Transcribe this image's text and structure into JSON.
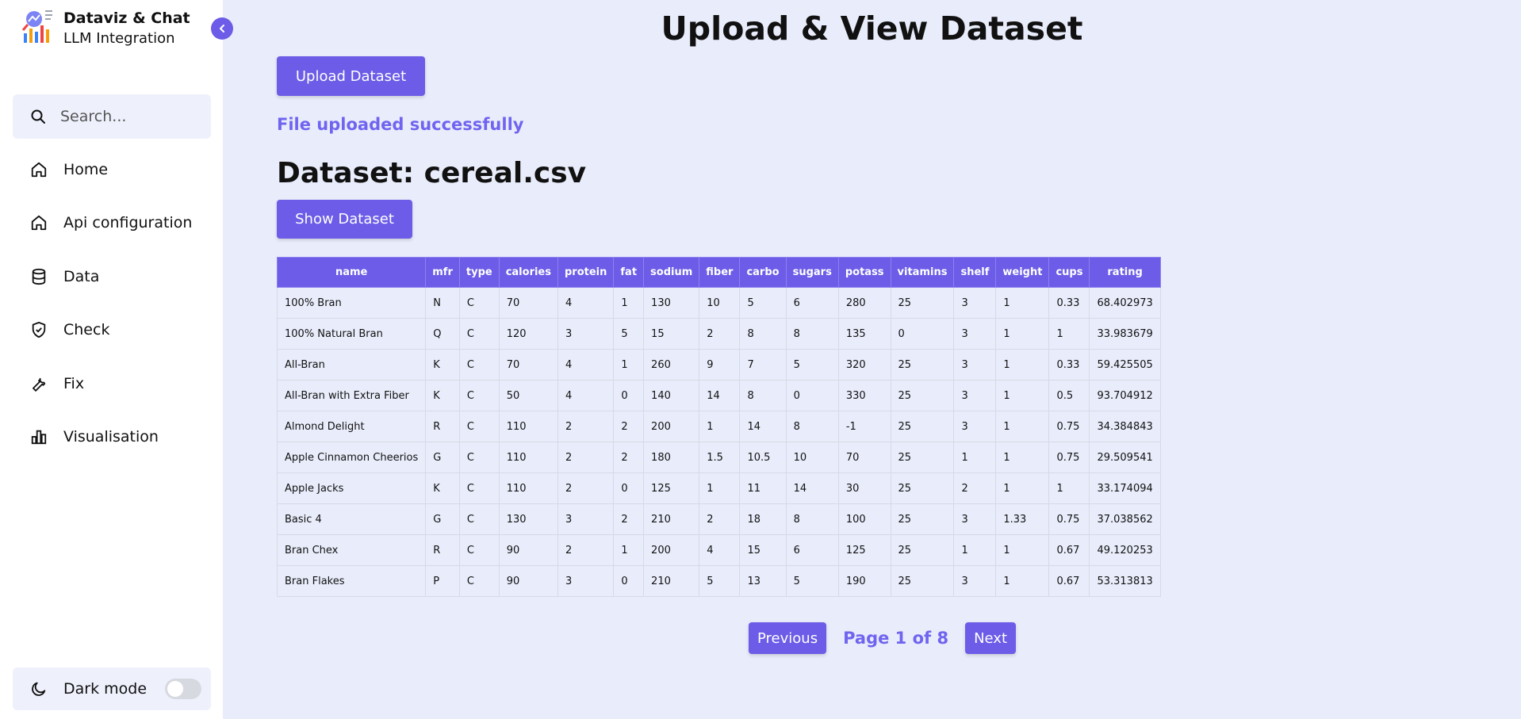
{
  "sidebar": {
    "brand": {
      "title": "Dataviz & Chat",
      "subtitle": "LLM Integration"
    },
    "search": {
      "placeholder": "Search..."
    },
    "items": [
      {
        "label": "Home",
        "icon": "home-icon"
      },
      {
        "label": "Api configuration",
        "icon": "home-icon"
      },
      {
        "label": "Data",
        "icon": "database-icon"
      },
      {
        "label": "Check",
        "icon": "shield-check-icon"
      },
      {
        "label": "Fix",
        "icon": "wrench-icon"
      },
      {
        "label": "Visualisation",
        "icon": "bar-chart-icon"
      }
    ],
    "dark_mode": {
      "label": "Dark mode",
      "enabled": false
    }
  },
  "main": {
    "title": "Upload & View Dataset",
    "upload_label": "Upload Dataset",
    "status": "File uploaded successfully",
    "dataset_title": "Dataset: cereal.csv",
    "show_label": "Show Dataset"
  },
  "table": {
    "columns": [
      "name",
      "mfr",
      "type",
      "calories",
      "protein",
      "fat",
      "sodium",
      "fiber",
      "carbo",
      "sugars",
      "potass",
      "vitamins",
      "shelf",
      "weight",
      "cups",
      "rating"
    ],
    "rows": [
      [
        "100% Bran",
        "N",
        "C",
        "70",
        "4",
        "1",
        "130",
        "10",
        "5",
        "6",
        "280",
        "25",
        "3",
        "1",
        "0.33",
        "68.402973"
      ],
      [
        "100% Natural Bran",
        "Q",
        "C",
        "120",
        "3",
        "5",
        "15",
        "2",
        "8",
        "8",
        "135",
        "0",
        "3",
        "1",
        "1",
        "33.983679"
      ],
      [
        "All-Bran",
        "K",
        "C",
        "70",
        "4",
        "1",
        "260",
        "9",
        "7",
        "5",
        "320",
        "25",
        "3",
        "1",
        "0.33",
        "59.425505"
      ],
      [
        "All-Bran with Extra Fiber",
        "K",
        "C",
        "50",
        "4",
        "0",
        "140",
        "14",
        "8",
        "0",
        "330",
        "25",
        "3",
        "1",
        "0.5",
        "93.704912"
      ],
      [
        "Almond Delight",
        "R",
        "C",
        "110",
        "2",
        "2",
        "200",
        "1",
        "14",
        "8",
        "-1",
        "25",
        "3",
        "1",
        "0.75",
        "34.384843"
      ],
      [
        "Apple Cinnamon Cheerios",
        "G",
        "C",
        "110",
        "2",
        "2",
        "180",
        "1.5",
        "10.5",
        "10",
        "70",
        "25",
        "1",
        "1",
        "0.75",
        "29.509541"
      ],
      [
        "Apple Jacks",
        "K",
        "C",
        "110",
        "2",
        "0",
        "125",
        "1",
        "11",
        "14",
        "30",
        "25",
        "2",
        "1",
        "1",
        "33.174094"
      ],
      [
        "Basic 4",
        "G",
        "C",
        "130",
        "3",
        "2",
        "210",
        "2",
        "18",
        "8",
        "100",
        "25",
        "3",
        "1.33",
        "0.75",
        "37.038562"
      ],
      [
        "Bran Chex",
        "R",
        "C",
        "90",
        "2",
        "1",
        "200",
        "4",
        "15",
        "6",
        "125",
        "25",
        "1",
        "1",
        "0.67",
        "49.120253"
      ],
      [
        "Bran Flakes",
        "P",
        "C",
        "90",
        "3",
        "0",
        "210",
        "5",
        "13",
        "5",
        "190",
        "25",
        "3",
        "1",
        "0.67",
        "53.313813"
      ]
    ]
  },
  "pagination": {
    "previous_label": "Previous",
    "page_info": "Page 1 of 8",
    "next_label": "Next"
  },
  "colors": {
    "accent": "#6c5ce7",
    "status_text": "#7064f0",
    "background": "#e9edfb"
  }
}
